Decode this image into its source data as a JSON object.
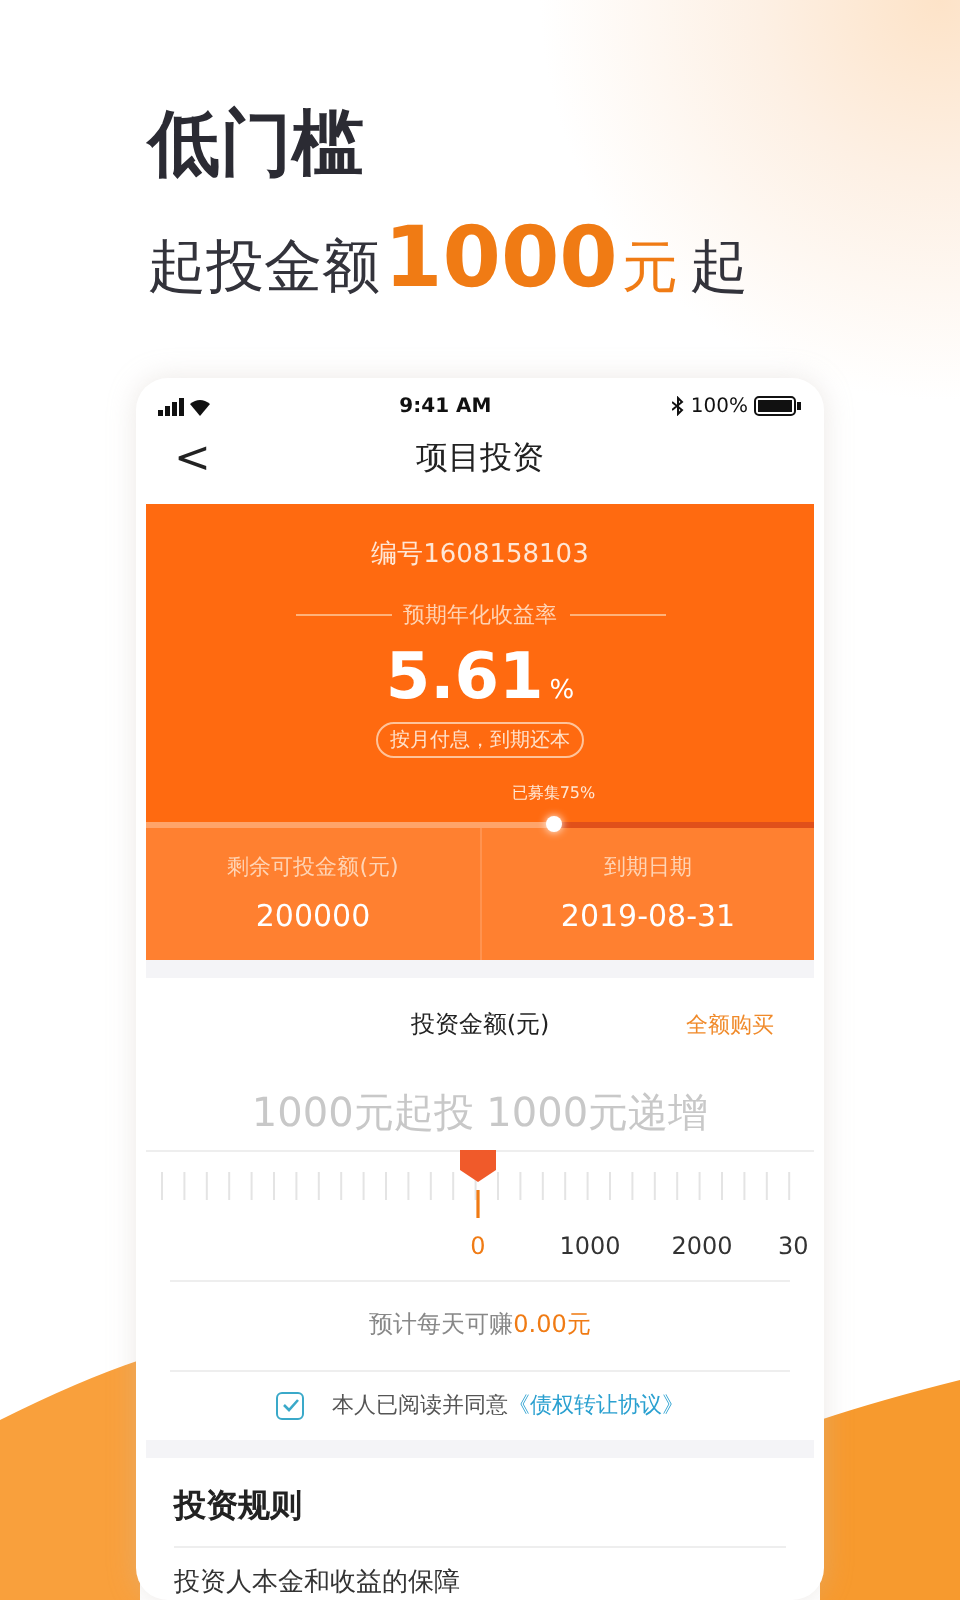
{
  "headline": "低门槛",
  "subline": {
    "prefix": "起投金额",
    "amount": "1000",
    "unit": "元",
    "suffix": "起"
  },
  "status_bar": {
    "time": "9:41 AM",
    "battery": "100%"
  },
  "nav": {
    "back": "<",
    "title": "项目投资"
  },
  "product": {
    "code": "编号1608158103",
    "rate_label": "预期年化收益率",
    "rate": "5.61",
    "rate_unit": "%",
    "repay": "按月付息，到期还本",
    "raised_label": "已募集75%",
    "progress": {
      "level": 0.61
    },
    "stats": [
      {
        "label": "剩余可投金额(元)",
        "value": "200000"
      },
      {
        "label": "到期日期",
        "value": "2019-08-31"
      }
    ]
  },
  "invest": {
    "title": "投资金额(元)",
    "buy_all": "全额购买",
    "placeholder": "1000元起投 1000元递增",
    "scale": [
      {
        "label": "0",
        "selected": true
      },
      {
        "label": "1000",
        "selected": false
      },
      {
        "label": "2000",
        "selected": false
      },
      {
        "label": "30",
        "selected": false
      }
    ],
    "earn_prefix": "预计每天可赚",
    "earn_value": "0.00元",
    "agree": {
      "checked": true,
      "text": "本人已阅读并同意",
      "link": "《债权转让协议》"
    }
  },
  "rules": {
    "title": "投资规则",
    "items": [
      "投资人本金和收益的保障"
    ]
  }
}
